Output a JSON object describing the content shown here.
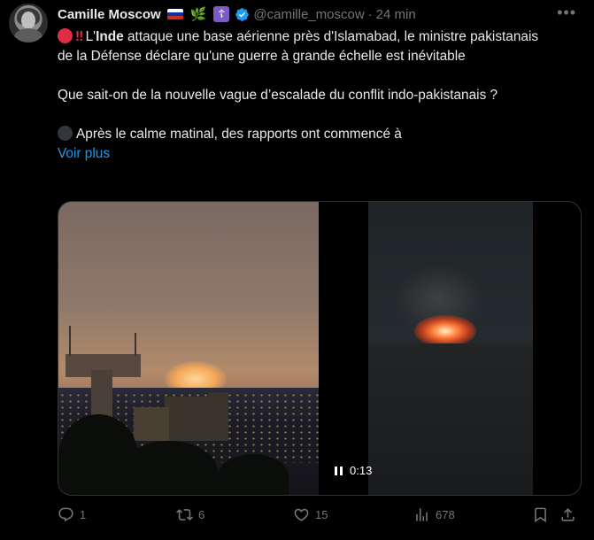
{
  "author": {
    "name": "Camille Moscow",
    "badge_emoji": "🌿",
    "cross_symbol": "☦",
    "handle": "@camille_moscow",
    "separator": "·",
    "time": "24 min"
  },
  "tweet": {
    "bangs": "‼",
    "line1_bold": "Inde",
    "line1_prefix": " L'",
    "line1_rest": " attaque une base aérienne près d'Islamabad, le ministre pakistanais de la Défense déclare qu'une guerre à grande échelle est inévitable",
    "line2": "Que sait-on de la nouvelle vague d’escalade du conflit indo-pakistanais ?",
    "line3": "Après le calme matinal, des rapports ont commencé à",
    "more_label": "Voir plus"
  },
  "media": {
    "time": "0:13"
  },
  "actions": {
    "replies": "1",
    "reposts": "6",
    "likes": "15",
    "views": "678"
  },
  "colors": {
    "accent": "#1d9bf0",
    "muted": "#71767b",
    "text": "#e7e9ea",
    "verified": "#1d9bf0",
    "alert_red": "#dd2e44"
  },
  "icons": [
    "more-icon",
    "verified-icon",
    "reply-icon",
    "repost-icon",
    "like-icon",
    "views-icon",
    "bookmark-icon",
    "share-icon",
    "pause-icon"
  ]
}
